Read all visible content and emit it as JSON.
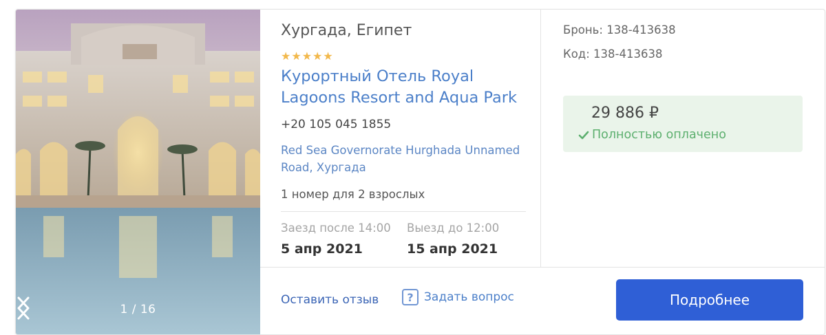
{
  "gallery": {
    "counter": "1 / 16",
    "prev_icon": "chevron-left-icon",
    "next_icon": "chevron-right-icon"
  },
  "hotel": {
    "location": "Хургада, Египет",
    "stars": "★★★★★",
    "star_rating": 5,
    "name": "Курортный Отель Royal Lagoons Resort and Aqua Park",
    "phone": "+20 105 045 1855",
    "address": "Red Sea Governorate Hurghada Unnamed Road, Хургада",
    "rooms": "1 номер для 2 взрослых"
  },
  "dates": {
    "checkin_label": "Заезд после 14:00",
    "checkin_value": "5 апр 2021",
    "checkout_label": "Выезд до 12:00",
    "checkout_value": "15 апр 2021"
  },
  "booking": {
    "booking_number": "Бронь: 138-413638",
    "code": "Код: 138-413638",
    "price": "29 886 ₽",
    "status": "Полностью оплачено"
  },
  "actions": {
    "review": "Оставить отзыв",
    "ask_icon": "?",
    "ask": "Задать вопрос",
    "details": "Подробнее"
  },
  "colors": {
    "link": "#4b7fc9",
    "primary_button": "#2f5fd6",
    "paid_green": "#5caf6e",
    "paid_bg": "#eaf4ea",
    "star": "#f2b84b"
  }
}
